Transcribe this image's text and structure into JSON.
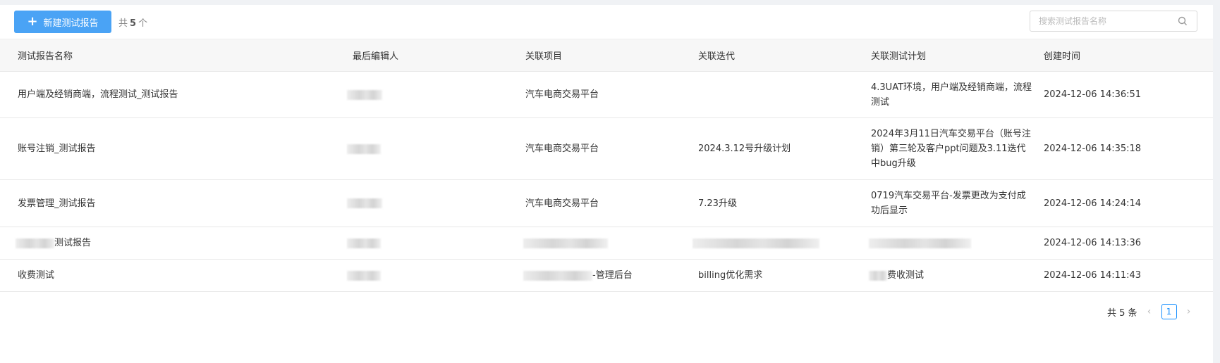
{
  "toolbar": {
    "new_button_label": "新建测试报告",
    "count_prefix": "共",
    "count_value": "5",
    "count_suffix": "个"
  },
  "search": {
    "placeholder": "搜索测试报告名称"
  },
  "table": {
    "columns": [
      "测试报告名称",
      "最后编辑人",
      "关联项目",
      "关联迭代",
      "关联测试计划",
      "创建时间"
    ],
    "rows": [
      {
        "name": "用户端及经销商端，流程测试_测试报告",
        "editor": "",
        "project": "汽车电商交易平台",
        "iteration": "",
        "plan": "4.3UAT环境，用户端及经销商端，流程测试",
        "created": "2024-12-06 14:36:51"
      },
      {
        "name": "账号注销_测试报告",
        "editor": "",
        "project": "汽车电商交易平台",
        "iteration": "2024.3.12号升级计划",
        "plan": "2024年3月11日汽车交易平台（账号注销）第三轮及客户ppt问题及3.11迭代中bug升级",
        "created": "2024-12-06 14:35:18"
      },
      {
        "name": "发票管理_测试报告",
        "editor": "",
        "project": "汽车电商交易平台",
        "iteration": "7.23升级",
        "plan": "0719汽车交易平台-发票更改为支付成功后显示",
        "created": "2024-12-06 14:24:14"
      },
      {
        "name": "测试报告",
        "editor": "",
        "project": "",
        "iteration": "",
        "plan": "",
        "created": "2024-12-06 14:13:36"
      },
      {
        "name": "收费测试",
        "editor": "",
        "project": "-管理后台",
        "iteration": "billing优化需求",
        "plan": "费收测试",
        "created": "2024-12-06 14:11:43"
      }
    ]
  },
  "pagination": {
    "total_label": "共 5 条",
    "current_page": "1"
  },
  "colors": {
    "accent": "#4aa3f5",
    "page_active": "#1890ff"
  }
}
